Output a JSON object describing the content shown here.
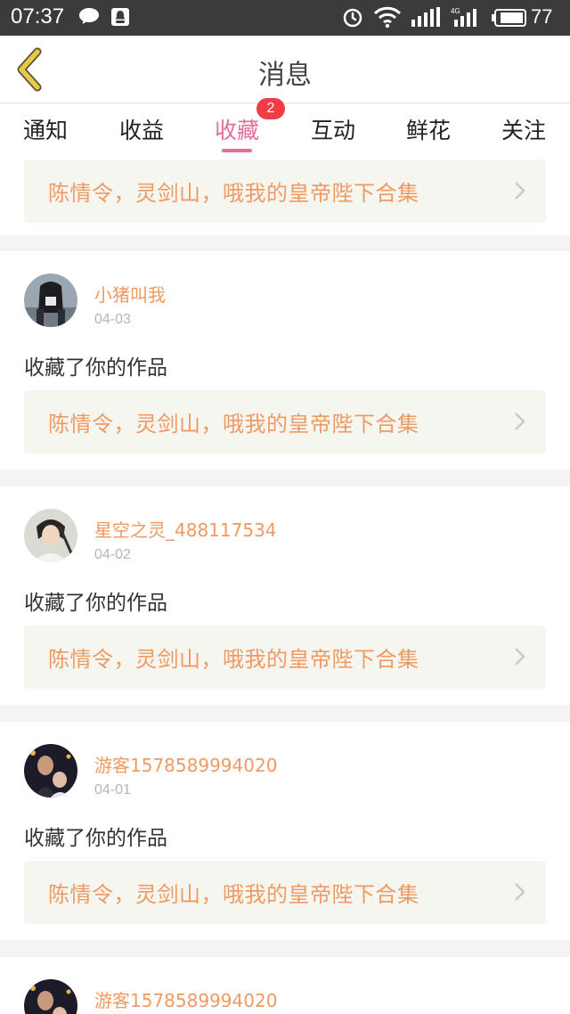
{
  "status_bar": {
    "time": "07:37",
    "battery": "77",
    "icons": [
      "chat-bubble-icon",
      "qq-icon",
      "alarm-icon",
      "wifi-icon",
      "signal-icon",
      "signal-4g-icon",
      "battery-icon"
    ]
  },
  "header": {
    "title": "消息",
    "back_icon": "chevron-left-icon",
    "accent_color": "#e6c84a"
  },
  "tabs": [
    {
      "label": "通知"
    },
    {
      "label": "收益"
    },
    {
      "label": "收藏",
      "badge": "2",
      "active": true
    },
    {
      "label": "互动"
    },
    {
      "label": "鲜花"
    },
    {
      "label": "关注"
    }
  ],
  "colors": {
    "active_tab": "#e36e9c",
    "badge": "#f23c45",
    "username": "#ef9a62",
    "work_title": "#ef9a62"
  },
  "feed": {
    "top_partial_work": "陈情令，灵剑山，哦我的皇帝陛下合集",
    "items": [
      {
        "user": "小猪叫我",
        "date": "04-03",
        "action": "收藏了你的作品",
        "work": "陈情令，灵剑山，哦我的皇帝陛下合集"
      },
      {
        "user": "星空之灵_488117534",
        "date": "04-02",
        "action": "收藏了你的作品",
        "work": "陈情令，灵剑山，哦我的皇帝陛下合集"
      },
      {
        "user": "游客1578589994020",
        "date": "04-01",
        "action": "收藏了你的作品",
        "work": "陈情令，灵剑山，哦我的皇帝陛下合集"
      },
      {
        "user": "游客1578589994020"
      }
    ]
  }
}
